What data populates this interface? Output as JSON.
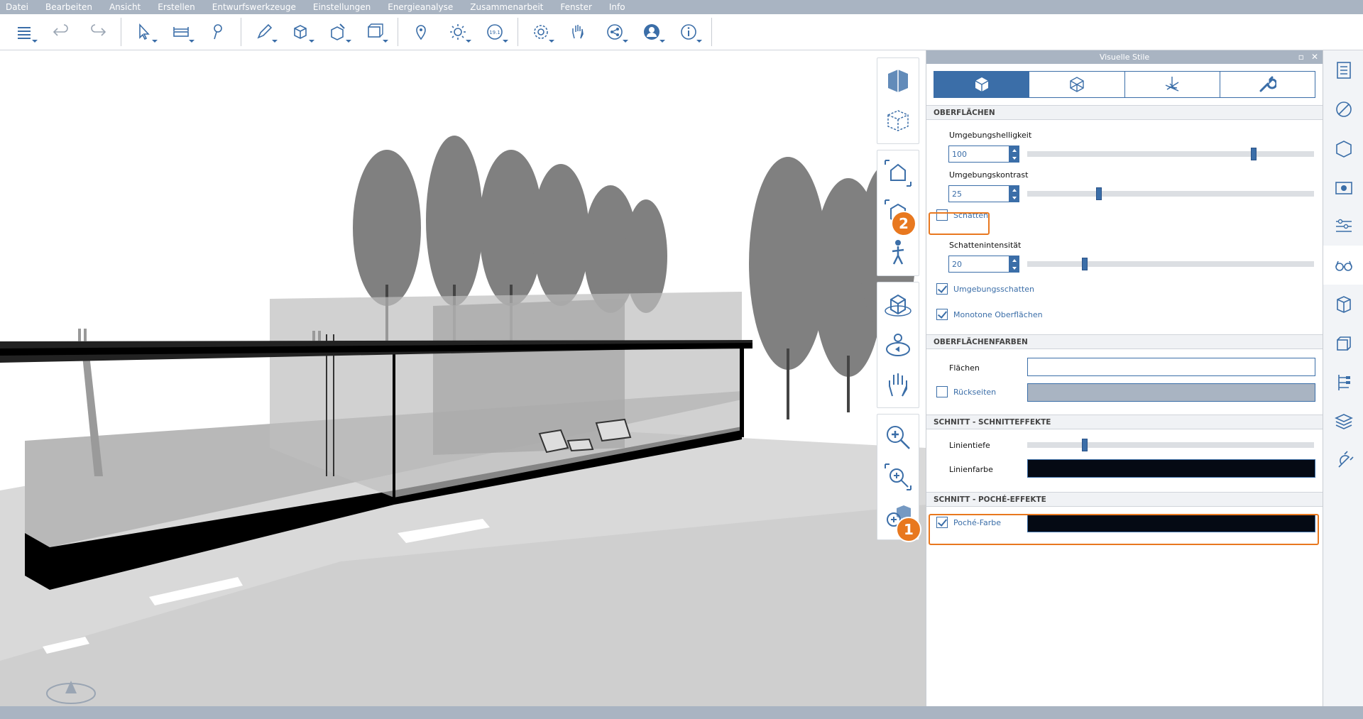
{
  "menu": [
    "Datei",
    "Bearbeiten",
    "Ansicht",
    "Erstellen",
    "Entwurfswerkzeuge",
    "Einstellungen",
    "Energieanalyse",
    "Zusammenarbeit",
    "Fenster",
    "Info"
  ],
  "toolbar": {
    "icons": [
      "layers-icon",
      "undo-icon",
      "redo-icon",
      "select-icon",
      "measure-icon",
      "dimension-icon",
      "draw-icon",
      "box-add-icon",
      "solid-edit-icon",
      "model-icon",
      "location-icon",
      "sun-icon",
      "date-icon",
      "settings-icon",
      "hand-icon",
      "share-icon",
      "user-icon",
      "info-icon"
    ],
    "date_badge": "19.1"
  },
  "panel": {
    "title": "Visuelle Stile",
    "restore_label": "▫",
    "close_label": "✕",
    "tabs": [
      "surfaces-tab",
      "wireframe-tab",
      "axes-tab",
      "tools-tab"
    ],
    "section_surfaces": "OBERFLÄCHEN",
    "ambient_brightness_label": "Umgebungshelligkeit",
    "ambient_brightness_value": "100",
    "ambient_brightness_level": 0.79,
    "ambient_contrast_label": "Umgebungskontrast",
    "ambient_contrast_value": "25",
    "ambient_contrast_level": 0.25,
    "shadows_label": "Schatten",
    "shadows_checked": false,
    "shadow_intensity_label": "Schattenintensität",
    "shadow_intensity_value": "20",
    "shadow_intensity_level": 0.2,
    "ambient_occlusion_label": "Umgebungsschatten",
    "ambient_occlusion_checked": true,
    "monotone_label": "Monotone Oberflächen",
    "monotone_checked": true,
    "section_colors": "OBERFLÄCHENFARBEN",
    "faces_label": "Flächen",
    "faces_color": "#ffffff",
    "backfaces_label": "Rückseiten",
    "backfaces_checked": false,
    "backfaces_color": "#a9b4c2",
    "section_cut_effects": "SCHNITT - SCHNITTEFFEKTE",
    "line_depth_label": "Linientiefe",
    "line_depth_level": 0.2,
    "line_color_label": "Linienfarbe",
    "line_color": "#050a14",
    "section_poche": "SCHNITT - POCHÉ-EFFEKTE",
    "poche_label": "Poché-Farbe",
    "poche_checked": true,
    "poche_color": "#050a14"
  },
  "callouts": [
    "1",
    "2"
  ],
  "accent": "#3b6ea8",
  "callout_color": "#e8781f"
}
